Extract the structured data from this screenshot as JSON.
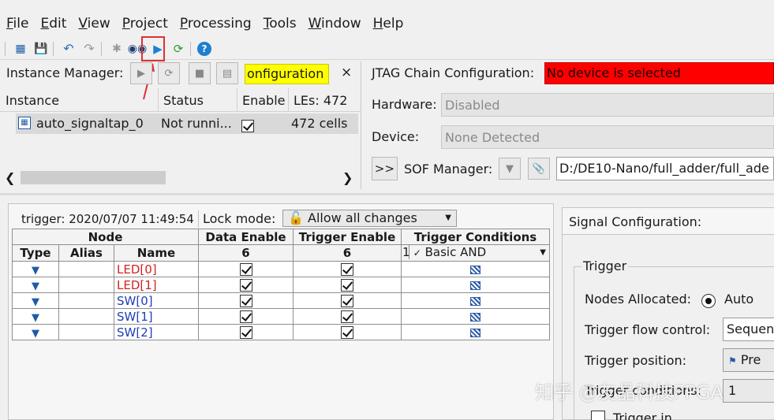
{
  "menu": {
    "items": [
      {
        "label": "File",
        "u": "F",
        "rest": "ile"
      },
      {
        "label": "Edit",
        "u": "E",
        "rest": "dit"
      },
      {
        "label": "View",
        "u": "V",
        "rest": "iew"
      },
      {
        "label": "Project",
        "u": "P",
        "rest": "roject"
      },
      {
        "label": "Processing",
        "u": "P",
        "rest": "rocessing"
      },
      {
        "label": "Tools",
        "u": "T",
        "rest": "ools"
      },
      {
        "label": "Window",
        "u": "W",
        "rest": "indow"
      },
      {
        "label": "Help",
        "u": "H",
        "rest": "elp"
      }
    ]
  },
  "instance_manager": {
    "label": "Instance Manager:",
    "config_status": "onfiguration",
    "close": "×",
    "columns": [
      "Instance",
      "Status",
      "Enable",
      "LEs: 472"
    ],
    "row": {
      "instance": "auto_signaltap_0",
      "status": "Not runni...",
      "les": "472 cells"
    }
  },
  "jtag": {
    "label": "JTAG Chain Configuration:",
    "status": "No device is selected",
    "hardware_label": "Hardware:",
    "hardware_value": "Disabled",
    "device_label": "Device:",
    "device_value": "None Detected",
    "expand_btn": ">>",
    "sof_label": "SOF Manager:",
    "sof_path": "D:/DE10-Nano/full_adder/full_ade"
  },
  "trigger_bar": {
    "trigger_time": "trigger: 2020/07/07 11:49:54",
    "lock_label": "Lock mode:",
    "lock_value": "Allow all changes"
  },
  "node_table": {
    "group_node": "Node",
    "col_data_enable": "Data Enable",
    "col_trigger_enable": "Trigger Enable",
    "col_trigger_conditions": "Trigger Conditions",
    "col_type": "Type",
    "col_alias": "Alias",
    "col_name": "Name",
    "data_enable_count": "6",
    "trigger_enable_count": "6",
    "cond_index": "1",
    "cond_value": "Basic AND",
    "rows": [
      {
        "name": "LED[0]",
        "color": "#d42020"
      },
      {
        "name": "LED[1]",
        "color": "#d42020"
      },
      {
        "name": "SW[0]",
        "color": "#1f3fb8"
      },
      {
        "name": "SW[1]",
        "color": "#1f3fb8"
      },
      {
        "name": "SW[2]",
        "color": "#1f3fb8"
      }
    ]
  },
  "signal_config": {
    "title": "Signal Configuration:",
    "trigger_group": "Trigger",
    "nodes_allocated_label": "Nodes Allocated:",
    "nodes_allocated_value": "Auto",
    "flow_label": "Trigger flow control:",
    "flow_value": "Sequen",
    "position_label": "Trigger position:",
    "position_value": "Pre",
    "conditions_label": "Trigger conditions:",
    "conditions_value": "1",
    "trigger_in_label": "Trigger in"
  },
  "watermark": "知乎 @友晶科技FPGA",
  "colors": {
    "accent_red": "#ff0000",
    "highlight_yellow": "#ffff00",
    "annotation_red": "#e03030"
  }
}
